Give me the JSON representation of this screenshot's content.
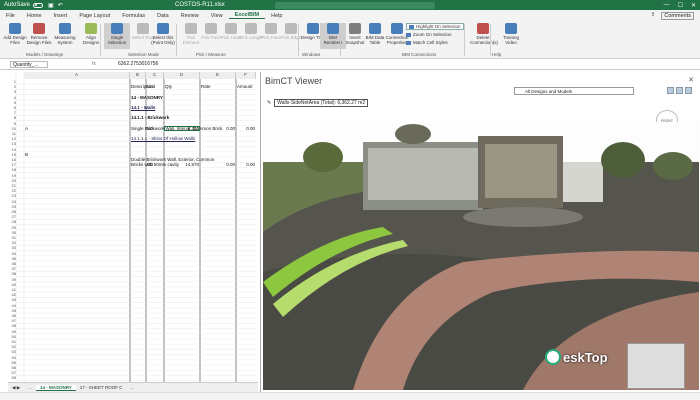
{
  "titlebar": {
    "autosave": "AutoSave",
    "filename": "COSTOS-R11.xlsx"
  },
  "menu": {
    "items": [
      "File",
      "Home",
      "Insert",
      "Page Layout",
      "Formulas",
      "Data",
      "Review",
      "View",
      "ExcelBIM",
      "Help"
    ],
    "active": "ExcelBIM",
    "comments": "Comments"
  },
  "ribbon": {
    "buttons": [
      {
        "label": "Add Design Files",
        "dim": false
      },
      {
        "label": "Remove Design Files",
        "dim": false
      },
      {
        "label": "Measuring System",
        "dim": false
      },
      {
        "label": "Align Designs",
        "dim": false
      },
      {
        "label": "Single Selection",
        "dim": false,
        "selected": true
      },
      {
        "label": "Select Row",
        "dim": true
      },
      {
        "label": "Select this (Point Only)",
        "dim": false
      },
      {
        "label": "Pick Element",
        "dim": true
      },
      {
        "label": "Pick Face",
        "dim": true
      },
      {
        "label": "Pick Lines",
        "dim": true
      },
      {
        "label": "Pick Length",
        "dim": true
      },
      {
        "label": "Pick Face",
        "dim": true
      },
      {
        "label": "Pick Edge",
        "dim": true
      },
      {
        "label": "Design Tree",
        "dim": false
      },
      {
        "label": "BIM Renderer",
        "dim": false,
        "selected": true
      },
      {
        "label": "Insert Snapshot",
        "dim": false
      },
      {
        "label": "BIM Data Table",
        "dim": false
      },
      {
        "label": "Connection Properties",
        "dim": false
      },
      {
        "label": "Delete Connection(s)",
        "dim": false
      },
      {
        "label": "Training Video",
        "dim": false
      }
    ],
    "small": [
      "Highlight On Selection",
      "Zoom On Selection",
      "Match Cell Styles"
    ],
    "groups": [
      "Models / Drawings",
      "Selection Mode",
      "Pick / Measure",
      "Windows",
      "BIM Connections",
      "Help"
    ]
  },
  "formula": {
    "namebox": "Quantity_...",
    "fx": "fx",
    "value": "6362.2753016756"
  },
  "sheet": {
    "columns": [
      "A",
      "B",
      "C",
      "D",
      "E",
      "F"
    ],
    "headers": {
      "b": "Description",
      "c": "Unit",
      "d": "Qty",
      "e": "Rate",
      "f": "Amount"
    },
    "rows": [
      {
        "n": "1"
      },
      {
        "n": "2",
        "b": "Description",
        "c": "Unit",
        "d": "Qty",
        "e": "Rate",
        "f": "Amount"
      },
      {
        "n": "3"
      },
      {
        "n": "4",
        "b": "14 - MASONRY",
        "bold": true
      },
      {
        "n": "5"
      },
      {
        "n": "6",
        "b": "14.1 - Walls",
        "bold": true,
        "link": true
      },
      {
        "n": "7"
      },
      {
        "n": "8",
        "b": "14.1.1 - Brickwork",
        "bold": true
      },
      {
        "n": "9"
      },
      {
        "n": "10",
        "a": "A",
        "b": "Single Brickwork Wall, Interior, Common Brick",
        "c": "M2",
        "d": "6,362",
        "e": "0.00",
        "f": "0.00"
      },
      {
        "n": "11"
      },
      {
        "n": "12",
        "b": "14.1.1.1 - Skins Of Hollow Walls",
        "link": true
      },
      {
        "n": "13"
      },
      {
        "n": "14"
      },
      {
        "n": "15",
        "a": "B"
      },
      {
        "n": "16",
        "b": "Double Brickwork Wall, Exterior, Common"
      },
      {
        "n": "17",
        "b": "Bricks  with 50mm cavity",
        "c": "M2",
        "d": "14,570",
        "e": "0.00",
        "f": "0.00"
      },
      {
        "n": "18"
      },
      {
        "n": "19"
      },
      {
        "n": "20"
      },
      {
        "n": "21"
      },
      {
        "n": "22"
      },
      {
        "n": "23"
      },
      {
        "n": "24"
      },
      {
        "n": "25"
      },
      {
        "n": "26"
      },
      {
        "n": "27"
      },
      {
        "n": "28"
      },
      {
        "n": "29"
      },
      {
        "n": "30"
      },
      {
        "n": "31"
      },
      {
        "n": "32"
      },
      {
        "n": "33"
      },
      {
        "n": "34"
      },
      {
        "n": "35"
      },
      {
        "n": "36"
      },
      {
        "n": "37"
      },
      {
        "n": "38"
      },
      {
        "n": "39"
      },
      {
        "n": "40"
      },
      {
        "n": "41"
      },
      {
        "n": "42"
      },
      {
        "n": "43"
      },
      {
        "n": "44"
      },
      {
        "n": "45"
      },
      {
        "n": "46"
      },
      {
        "n": "47"
      },
      {
        "n": "48"
      },
      {
        "n": "49"
      },
      {
        "n": "50"
      },
      {
        "n": "51"
      },
      {
        "n": "52"
      },
      {
        "n": "53"
      },
      {
        "n": "54"
      },
      {
        "n": "55"
      },
      {
        "n": "56"
      },
      {
        "n": "57"
      },
      {
        "n": "58"
      }
    ]
  },
  "tabs": {
    "items": [
      "...",
      "14 - MASONRY",
      "17 - SHEET ROOF C",
      "..."
    ],
    "active": "14 - MASONRY"
  },
  "viewer": {
    "title": "BimCT Viewer",
    "close": "✕",
    "badge": "Walls-SideNetArea (Total): 6,362.27 m2",
    "models": "All Designs and Models",
    "cube": "FRONT"
  },
  "watermark": {
    "text": "eskTop"
  },
  "colors": {
    "excel_green": "#217346",
    "ground": "#55544d",
    "path": "#a0786a",
    "lawn": "#8dc73f"
  }
}
